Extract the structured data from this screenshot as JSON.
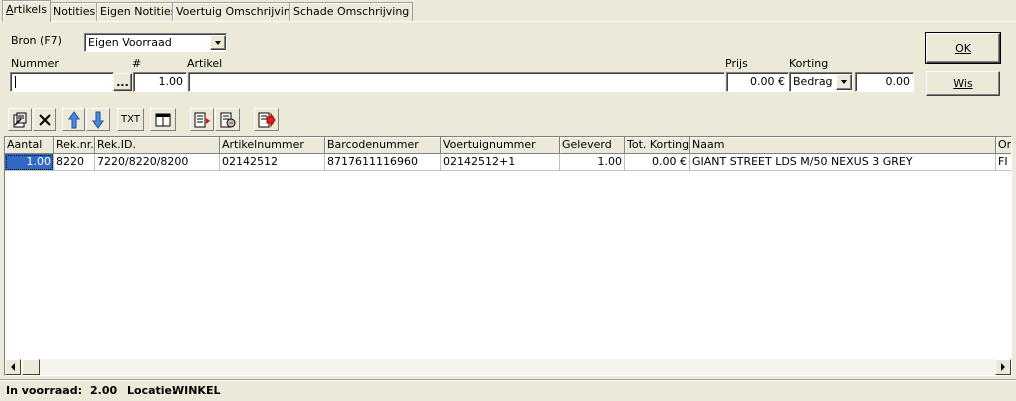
{
  "tabs": [
    {
      "label_first": "A",
      "label_rest": "rtikels"
    },
    {
      "label": "Notities"
    },
    {
      "label": "Eigen Notities"
    },
    {
      "label": "Voertuig Omschrijving"
    },
    {
      "label": "Schade Omschrijving"
    }
  ],
  "form": {
    "bron_label": "Bron (F7)",
    "bron_value": "Eigen Voorraad",
    "nummer_label": "Nummer",
    "nummer_value": "",
    "ellipsis": "...",
    "count_label": "#",
    "count_value": "1.00",
    "artikel_label": "Artikel",
    "artikel_value": "",
    "prijs_label": "Prijs",
    "prijs_value": "0.00 €",
    "korting_label": "Korting",
    "korting_type": "Bedrag",
    "korting_value": "0.00"
  },
  "buttons": {
    "ok_label": "OK",
    "wis_label": "Wis"
  },
  "toolbar": {
    "txt_label": "TXT"
  },
  "grid": {
    "columns": [
      "Aantal",
      "Rek.nr.",
      "Rek.ID.",
      "Artikelnummer",
      "Barcodenummer",
      "Voertuignummer",
      "Geleverd",
      "Tot. Korting",
      "Naam",
      "On"
    ],
    "rows": [
      [
        "1.00",
        "8220",
        "7220/8220/8200",
        "02142512",
        "8717611116960",
        "02142512+1",
        "1.00",
        "0.00 €",
        "GIANT STREET LDS M/50 NEXUS 3 GREY",
        "FI"
      ]
    ]
  },
  "status": {
    "voorraad_label": "In voorraad:",
    "voorraad_value": "2.00",
    "locatie_label": "Locatie:",
    "locatie_value": "WINKEL"
  },
  "colors": {
    "selection": "#316ac5",
    "background": "#ece9d8"
  }
}
